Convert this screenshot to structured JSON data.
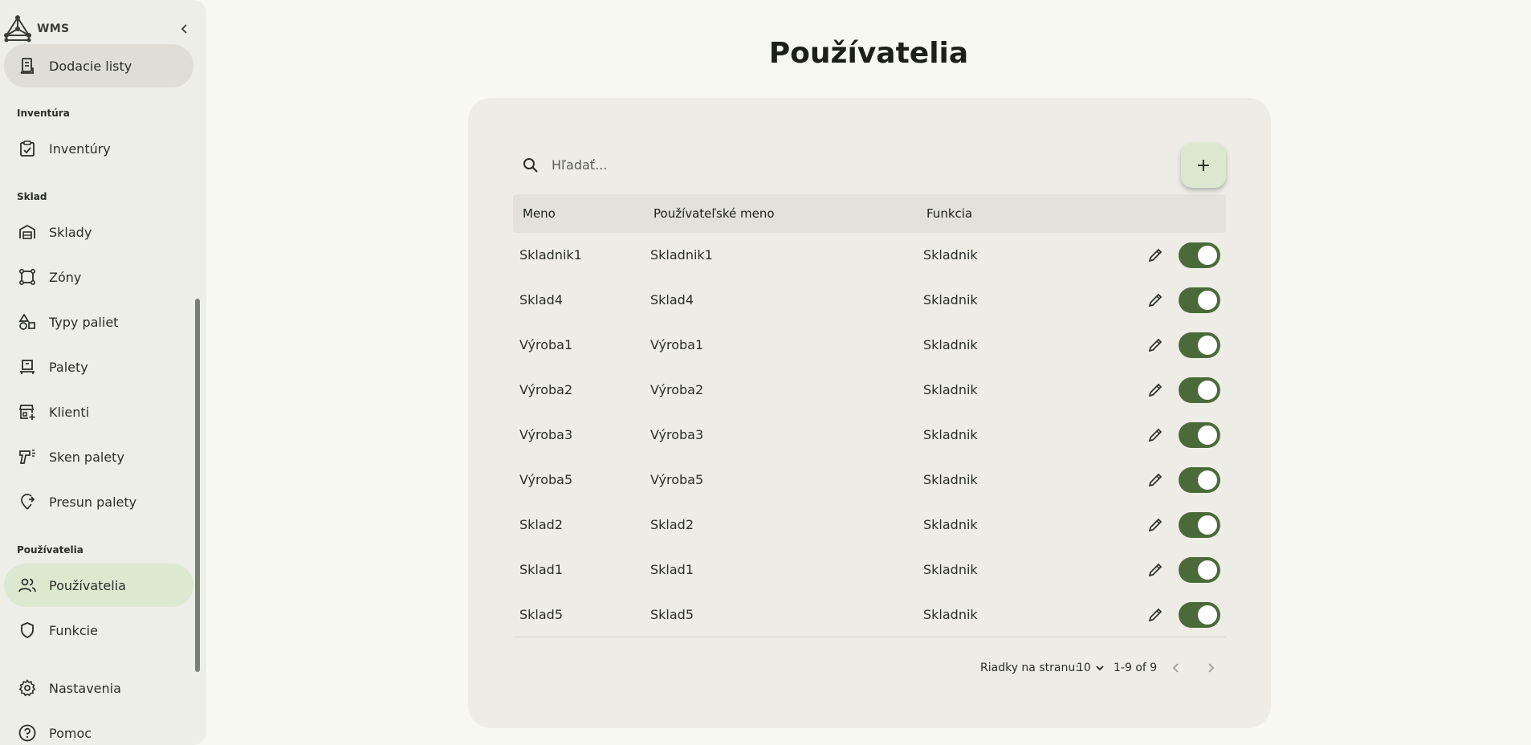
{
  "app": {
    "name": "WMS"
  },
  "sidebar": {
    "top_item": {
      "label": "Dodacie listy",
      "icon": "receipt-icon"
    },
    "sections": {
      "inventory": "Inventúra",
      "warehouse": "Sklad",
      "users": "Používatelia"
    },
    "items": [
      {
        "label": "Inventúry",
        "icon": "clipboard-check-icon"
      },
      {
        "label": "Sklady",
        "icon": "warehouse-icon"
      },
      {
        "label": "Zóny",
        "icon": "zone-icon"
      },
      {
        "label": "Typy paliet",
        "icon": "shapes-icon"
      },
      {
        "label": "Palety",
        "icon": "pallet-icon"
      },
      {
        "label": "Klienti",
        "icon": "store-add-icon"
      },
      {
        "label": "Sken palety",
        "icon": "scanner-icon"
      },
      {
        "label": "Presun palety",
        "icon": "move-icon"
      },
      {
        "label": "Používatelia",
        "icon": "users-icon",
        "active": true
      },
      {
        "label": "Funkcie",
        "icon": "shield-icon"
      }
    ],
    "bottom": [
      {
        "label": "Nastavenia",
        "icon": "gear-icon"
      },
      {
        "label": "Pomoc",
        "icon": "help-icon"
      }
    ]
  },
  "main": {
    "title": "Používatelia",
    "search": {
      "placeholder": "Hľadať...",
      "value": ""
    },
    "table": {
      "columns": [
        "Meno",
        "Používateľské meno",
        "Funkcia"
      ],
      "rows": [
        [
          "Skladnik1",
          "Skladnik1",
          "Skladnik"
        ],
        [
          "Sklad4",
          "Sklad4",
          "Skladnik"
        ],
        [
          "Výroba1",
          "Výroba1",
          "Skladnik"
        ],
        [
          "Výroba2",
          "Výroba2",
          "Skladnik"
        ],
        [
          "Výroba3",
          "Výroba3",
          "Skladnik"
        ],
        [
          "Výroba5",
          "Výroba5",
          "Skladnik"
        ],
        [
          "Sklad2",
          "Sklad2",
          "Skladnik"
        ],
        [
          "Sklad1",
          "Sklad1",
          "Skladnik"
        ],
        [
          "Sklad5",
          "Sklad5",
          "Skladnik"
        ]
      ],
      "active_states": [
        true,
        true,
        true,
        true,
        true,
        true,
        true,
        true,
        true
      ]
    },
    "pagination": {
      "rows_label": "Riadky na stranu:",
      "rows_per_page": "10",
      "range": "1-9 of 9"
    }
  },
  "colors": {
    "accent": "#4b6a3a",
    "active_nav": "#dde8d1",
    "card": "#edede6"
  }
}
